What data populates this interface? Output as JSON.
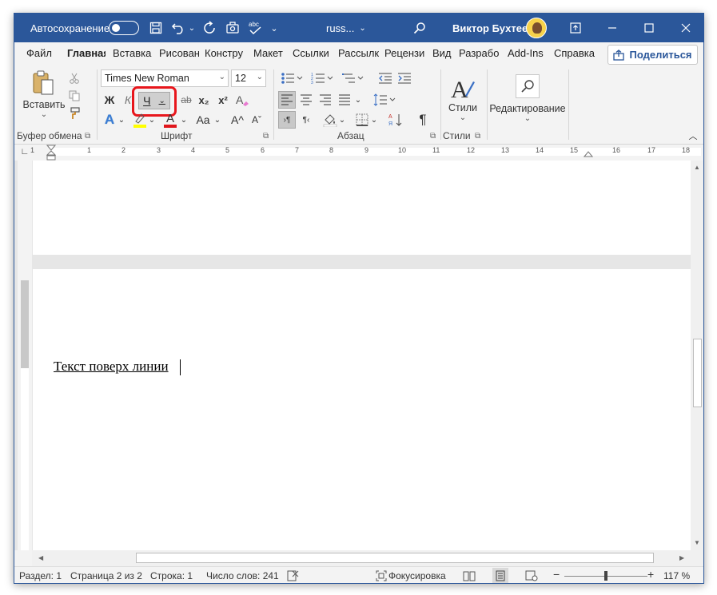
{
  "titlebar": {
    "autosave_label": "Автосохранение",
    "autosave_state": "off",
    "doc_title": "russ...",
    "doc_title_chevron": "⌄",
    "user_name": "Виктор Бухтеев",
    "icons": [
      "save-icon",
      "undo-icon",
      "redo-icon",
      "touch-mode-icon",
      "spelling-icon",
      "customize-qat-icon",
      "search-icon",
      "ribbon-display-icon",
      "minimize-icon",
      "maximize-icon",
      "close-icon"
    ]
  },
  "tabs": [
    {
      "label": "Файл"
    },
    {
      "label": "Главная",
      "active": true
    },
    {
      "label": "Вставка"
    },
    {
      "label": "Рисован"
    },
    {
      "label": "Констру"
    },
    {
      "label": "Макет"
    },
    {
      "label": "Ссылки"
    },
    {
      "label": "Рассылк"
    },
    {
      "label": "Рецензи"
    },
    {
      "label": "Вид"
    },
    {
      "label": "Разрабо"
    },
    {
      "label": "Add-Ins"
    },
    {
      "label": "Справка"
    }
  ],
  "share_button": {
    "label": "Поделиться"
  },
  "ribbon": {
    "clipboard": {
      "paste_label": "Вставить",
      "group_label": "Буфер обмена"
    },
    "font": {
      "font_name": "Times New Roman",
      "font_size": "12",
      "bold": "Ж",
      "italic": "К",
      "underline": "Ч",
      "strikethrough": "ab",
      "subscript": "x₂",
      "superscript": "x²",
      "change_case": "Aa",
      "grow_font": "A^",
      "shrink_font": "Aˇ",
      "text_effects": "A",
      "font_color": "A",
      "group_label": "Шрифт"
    },
    "paragraph": {
      "group_label": "Абзац",
      "pilcrow": "¶"
    },
    "styles": {
      "label": "Стили",
      "group_label": "Стили"
    },
    "editing": {
      "label": "Редактирование"
    }
  },
  "ruler": {
    "numbers": [
      "1",
      "1",
      "2",
      "3",
      "4",
      "5",
      "6",
      "7",
      "8",
      "9",
      "10",
      "11",
      "12",
      "13",
      "14",
      "15",
      "16",
      "17",
      "18"
    ]
  },
  "document": {
    "text": "Текст поверх линии"
  },
  "statusbar": {
    "section": "Раздел: 1",
    "page": "Страница 2 из 2",
    "line": "Строка: 1",
    "words": "Число слов: 241",
    "focus": "Фокусировка",
    "zoom_minus": "−",
    "zoom_plus": "+",
    "zoom": "117 %"
  },
  "colors": {
    "accent": "#2b579a",
    "highlight_box": "#e8161c",
    "highlight_yellow": "#ffff00",
    "font_red": "#e0161c"
  }
}
